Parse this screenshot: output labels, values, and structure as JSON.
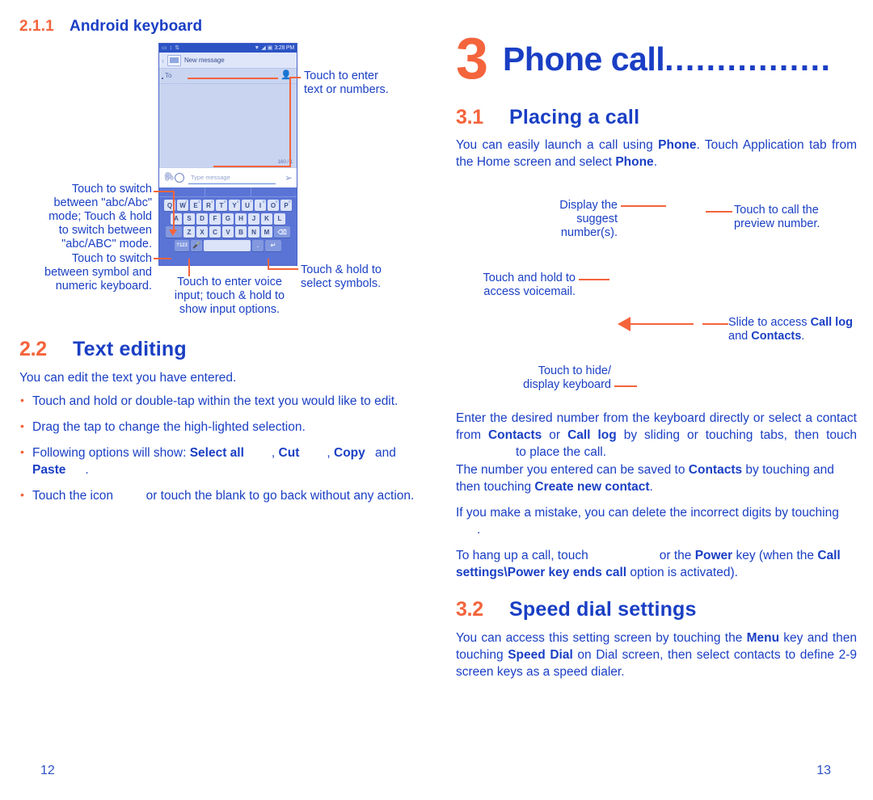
{
  "left_column": {
    "section_2_1_1": {
      "number": "2.1.1",
      "title": "Android keyboard"
    },
    "phone_mock": {
      "status_bar": {
        "time": "3:28 PM"
      },
      "title_bar": {
        "label": "New message"
      },
      "message_area": {
        "to_label": "To",
        "char_counter": "160 / 1"
      },
      "compose_bar": {
        "placeholder": "Type message"
      },
      "keyboard": {
        "row1": [
          "Q",
          "W",
          "E",
          "R",
          "T",
          "Y",
          "U",
          "I",
          "O",
          "P"
        ],
        "row1_sup": [
          "1",
          "2",
          "3",
          "4",
          "5",
          "6",
          "7",
          "8",
          "9",
          "0"
        ],
        "row2": [
          "A",
          "S",
          "D",
          "F",
          "G",
          "H",
          "J",
          "K",
          "L"
        ],
        "row3_shift": "⇧",
        "row3": [
          "Z",
          "X",
          "C",
          "V",
          "B",
          "N",
          "M"
        ],
        "row3_delete": "⌫",
        "row4_symbols": "?123",
        "row4_mic": "🎤",
        "row4_space": "",
        "row4_period": ".",
        "row4_enter": "↵"
      }
    },
    "callouts": {
      "enter_text": "Touch to enter\ntext or numbers.",
      "switch_abc": "Touch to switch\nbetween \"abc/Abc\"\nmode; Touch & hold\nto switch between\n\"abc/ABC\" mode.",
      "switch_symbol": "Touch to switch\nbetween symbol and\nnumeric keyboard.",
      "voice_input": "Touch to enter voice\ninput; touch & hold to\nshow input options.",
      "select_symbols": "Touch & hold to\nselect symbols."
    },
    "section_2_2": {
      "number": "2.2",
      "title": "Text editing",
      "intro": "You can edit the text you have entered.",
      "bullets": [
        {
          "text_before": "Touch and hold or double-tap within the text you would like to edit.",
          "bold": []
        },
        {
          "text_before": "Drag the tap to change the high-lighted selection.",
          "bold": []
        },
        {
          "prefix": "Following options will show: ",
          "b1": "Select all",
          "sep1": ", ",
          "b2": "Cut",
          "sep2": ", ",
          "b3": "Copy",
          "sep3": " and ",
          "b4": "Paste",
          "suffix": "."
        },
        {
          "prefix2": "Touch the icon ",
          "suffix2": " or touch the blank to go back without any action."
        }
      ]
    },
    "page_number": "12"
  },
  "right_column": {
    "chapter": {
      "number": "3",
      "title": "Phone call",
      "dots": "................"
    },
    "section_3_1": {
      "number": "3.1",
      "title": "Placing a call",
      "intro_a": "You can easily launch a call using ",
      "intro_b1": "Phone",
      "intro_c": ". Touch Application tab from the Home screen and select ",
      "intro_b2": "Phone",
      "intro_d": "."
    },
    "callouts": {
      "display_suggest": "Display the\nsuggest\nnumber(s).",
      "touch_call_preview": "Touch to call the\npreview number.",
      "voicemail": "Touch and hold to\naccess voicemail.",
      "slide_access_a": "Slide to access ",
      "slide_access_b1": "Call log",
      "slide_access_c": " and ",
      "slide_access_b2": "Contacts",
      "slide_access_d": ".",
      "hide_keyboard": "Touch to hide/\ndisplay keyboard"
    },
    "paragraphs": {
      "p1_a": "Enter the desired number from the keyboard directly or select a contact from ",
      "p1_b1": "Contacts",
      "p1_c": " or ",
      "p1_b2": "Call log",
      "p1_d": " by sliding or touching tabs, then touch",
      "p1_e": "to place the call.",
      "p2_a": "The number you entered can be saved to ",
      "p2_b1": "Contacts",
      "p2_c": " by touching and then touching ",
      "p2_b2": "Create new contact",
      "p2_d": ".",
      "p3_a": "If you make a mistake, you can delete the incorrect digits by touching",
      "p3_b": ".",
      "p4_a": "To hang up a call, touch",
      "p4_b": "or the ",
      "p4_b1": "Power",
      "p4_c": " key (when the ",
      "p4_b2": "Call settings\\Power key ends call",
      "p4_d": " option is activated)."
    },
    "section_3_2": {
      "number": "3.2",
      "title": "Speed dial settings",
      "body_a": "You can access this setting screen by touching the ",
      "body_b1": "Menu",
      "body_c": " key and then touching ",
      "body_b2": "Speed Dial",
      "body_d": " on Dial screen, then select contacts to define 2-9 screen keys as a speed dialer."
    },
    "page_number": "13"
  },
  "colors": {
    "blue": "#1a3fc4",
    "orange": "#f4643c",
    "phone_blue": "#5a74d6"
  }
}
